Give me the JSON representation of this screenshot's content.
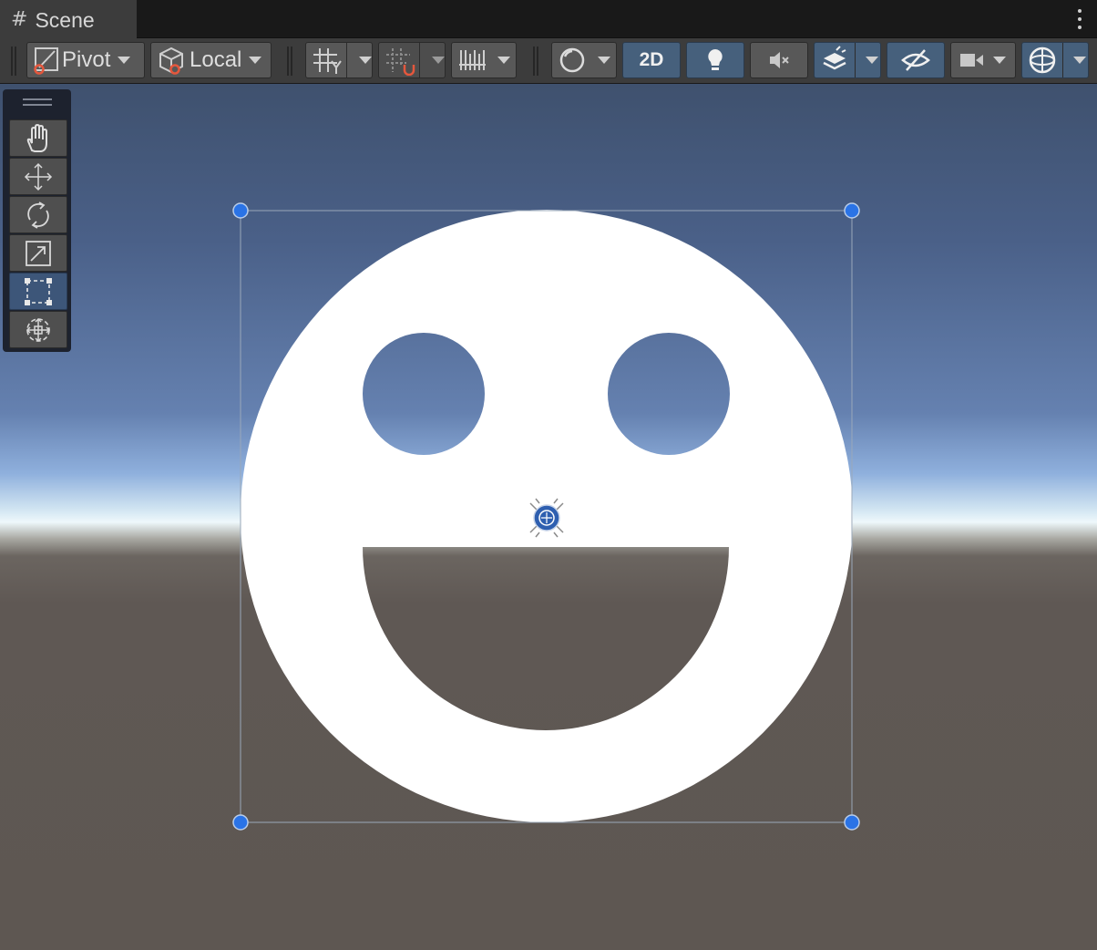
{
  "window": {
    "tab_icon": "#",
    "tab_label": "Scene",
    "menu_icon": "kebab-menu-icon"
  },
  "toolbar": {
    "pivot_label": "Pivot",
    "local_label": "Local",
    "mode_2d_label": "2D",
    "icons": [
      "pivot-icon",
      "local-space-icon",
      "grid-icon",
      "snap-icon",
      "increment-snap-icon",
      "shading-mode-icon",
      "lighting-icon",
      "audio-mute-icon",
      "effects-icon",
      "hidden-objects-icon",
      "camera-icon",
      "gizmos-icon"
    ],
    "active_toggles": [
      "2D",
      "lighting",
      "effects",
      "hidden-objects",
      "gizmos"
    ]
  },
  "tools": {
    "items": [
      "hand-tool",
      "move-tool",
      "rotate-tool",
      "scale-tool",
      "rect-tool",
      "transform-tool"
    ],
    "active": "rect-tool"
  },
  "scene": {
    "object": "smiley-face-sprite",
    "selection": "rect-transform-handles",
    "colors": {
      "sprite": "#ffffff",
      "handle": "#2a73e6",
      "sky_top": "#3f516e",
      "horizon": "#eef8fb",
      "ground": "#5e5752"
    }
  }
}
